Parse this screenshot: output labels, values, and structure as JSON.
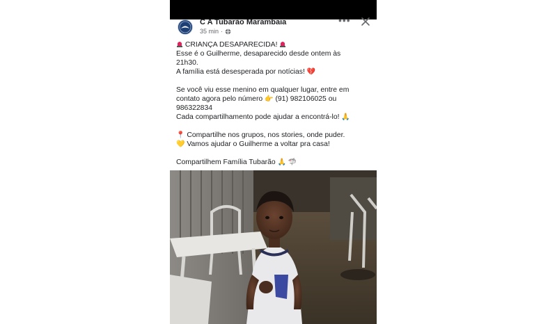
{
  "post": {
    "page_name": "C A Tubarão Marambaia",
    "time": "35 min",
    "more_icon": "more-icon",
    "close_icon": "close-icon",
    "lines": {
      "l1": "CRIANÇA DESAPARECIDA!",
      "l2": "Esse é o Guilherme, desaparecido desde ontem às",
      "l3": "21h30.",
      "l4": "A família está desesperada por notícias!",
      "l5": "Se você viu esse menino em qualquer lugar, entre em",
      "l6": "contato agora pelo número",
      "l6b": "(91) 982106025 ou",
      "l7": "986322834",
      "l8": "Cada compartilhamento pode ajudar a encontrá-lo!",
      "l9": "Compartilhe nos grupos, nos stories, onde puder.",
      "l10": "Vamos ajudar o Guilherme a voltar pra casa!",
      "l11": "Compartilhem Família Tubarão"
    },
    "emoji": {
      "heart": "💔",
      "point": "👉",
      "pray": "🙏",
      "pin": "📍",
      "yellow_heart": "💛",
      "shark": "🦈"
    }
  },
  "colors": {
    "text": "#1c1e21",
    "meta": "#65676b",
    "statusbar": "#000000",
    "siren": "#e0245e"
  }
}
